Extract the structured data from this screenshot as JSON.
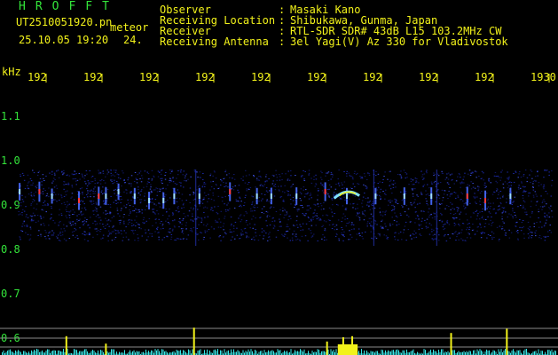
{
  "header": {
    "logo": "HROFFT",
    "filename": "UT2510051920.pn",
    "suffix": "meteor",
    "datetime": "25.10.05 19:20",
    "count": "24.",
    "info": [
      {
        "label": "Observer",
        "value": "Masaki Kano"
      },
      {
        "label": "Receiving Location",
        "value": "Shibukawa, Gunma, Japan"
      },
      {
        "label": "Receiver",
        "value": "RTL-SDR SDR# 43dB L15 103.2MHz CW"
      },
      {
        "label": "Receiving Antenna",
        "value": "3el Yagi(V) Az 330 for Vladivostok"
      }
    ]
  },
  "colors": {
    "label_green": "#33e43a",
    "label_yellow": "#f2f21a",
    "ping_red": "#ff3b3b",
    "noise_blue": "#1c2aa8",
    "power_cyan": "#38e6e6",
    "gridline": "#8a8a8a"
  },
  "chart_data": {
    "type": "heatmap",
    "ylabel": "kHz",
    "y_ticks": [
      "1.1",
      "1.0",
      "0.9",
      "0.8",
      "0.7",
      "0.6"
    ],
    "ylim": [
      0.58,
      1.16
    ],
    "x_ticks": [
      "192",
      "192",
      "192",
      "192",
      "192",
      "192",
      "192",
      "192",
      "192",
      "1930"
    ],
    "signal_band_khz": [
      0.82,
      0.98
    ],
    "pings": [
      {
        "minute": 0.4,
        "khz": 0.93,
        "strength": 0.7
      },
      {
        "minute": 1.5,
        "khz": 0.93,
        "strength": 0.9
      },
      {
        "minute": 2.2,
        "khz": 0.92,
        "strength": 0.5
      },
      {
        "minute": 3.7,
        "khz": 0.91,
        "strength": 0.8
      },
      {
        "minute": 4.8,
        "khz": 0.92,
        "strength": 0.8
      },
      {
        "minute": 5.2,
        "khz": 0.92,
        "strength": 0.7
      },
      {
        "minute": 5.9,
        "khz": 0.93,
        "strength": 0.6
      },
      {
        "minute": 6.8,
        "khz": 0.92,
        "strength": 0.6
      },
      {
        "minute": 7.6,
        "khz": 0.91,
        "strength": 0.7
      },
      {
        "minute": 8.4,
        "khz": 0.91,
        "strength": 0.6
      },
      {
        "minute": 9.0,
        "khz": 0.92,
        "strength": 0.6
      },
      {
        "minute": 10.4,
        "khz": 0.92,
        "strength": 0.6
      },
      {
        "minute": 12.1,
        "khz": 0.93,
        "strength": 0.8
      },
      {
        "minute": 13.6,
        "khz": 0.92,
        "strength": 0.6
      },
      {
        "minute": 14.4,
        "khz": 0.92,
        "strength": 0.6
      },
      {
        "minute": 15.8,
        "khz": 0.92,
        "strength": 0.7
      },
      {
        "minute": 17.4,
        "khz": 0.93,
        "strength": 0.8
      },
      {
        "minute": 18.6,
        "khz": 0.92,
        "strength": 0.6
      },
      {
        "minute": 20.2,
        "khz": 0.92,
        "strength": 0.6
      },
      {
        "minute": 21.8,
        "khz": 0.92,
        "strength": 0.7
      },
      {
        "minute": 23.3,
        "khz": 0.92,
        "strength": 0.7
      },
      {
        "minute": 25.3,
        "khz": 0.92,
        "strength": 0.8
      },
      {
        "minute": 26.3,
        "khz": 0.91,
        "strength": 0.9
      },
      {
        "minute": 27.7,
        "khz": 0.92,
        "strength": 0.6
      }
    ],
    "head_echo": {
      "minute_start": 17.9,
      "minute_end": 19.3,
      "khz": 0.925
    },
    "power_spikes": [
      {
        "minute": 3.0,
        "level": 0.55
      },
      {
        "minute": 5.2,
        "level": 0.2
      },
      {
        "minute": 10.1,
        "level": 0.95
      },
      {
        "minute": 17.5,
        "level": 0.3
      },
      {
        "minute": 18.4,
        "level": 0.5
      },
      {
        "minute": 18.9,
        "level": 0.55
      },
      {
        "minute": 24.4,
        "level": 0.7
      },
      {
        "minute": 27.5,
        "level": 0.9
      }
    ],
    "power_scale_lines": 3
  }
}
